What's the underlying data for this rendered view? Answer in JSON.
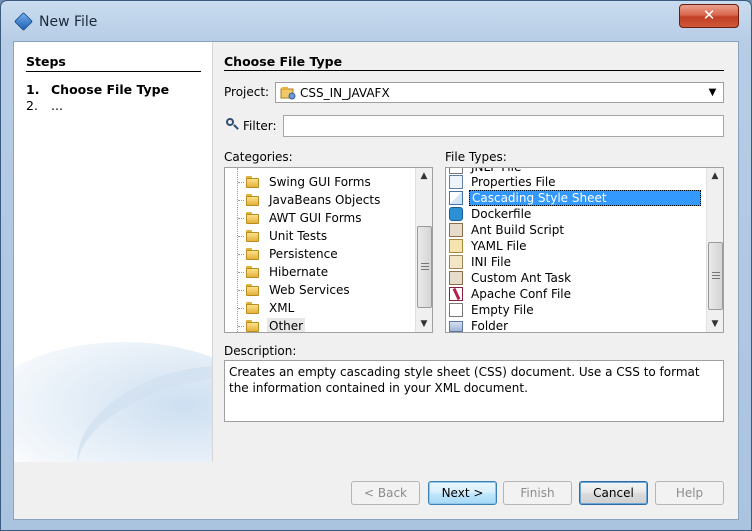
{
  "window": {
    "title": "New File",
    "close_glyph": "✕"
  },
  "steps": {
    "title": "Steps",
    "items": [
      {
        "num": "1.",
        "label": "Choose File Type",
        "active": true
      },
      {
        "num": "2.",
        "label": "...",
        "active": false
      }
    ]
  },
  "main": {
    "title": "Choose File Type",
    "project_label": "Project:",
    "project_value": "CSS_IN_JAVAFX",
    "filter_label": "Filter:",
    "filter_value": "",
    "categories_label": "Categories:",
    "file_types_label": "File Types:",
    "categories": [
      {
        "label": "Swing GUI Forms",
        "icon": "folder-icon"
      },
      {
        "label": "JavaBeans Objects",
        "icon": "folder-icon"
      },
      {
        "label": "AWT GUI Forms",
        "icon": "folder-icon"
      },
      {
        "label": "Unit Tests",
        "icon": "folder-icon"
      },
      {
        "label": "Persistence",
        "icon": "folder-icon"
      },
      {
        "label": "Hibernate",
        "icon": "folder-icon"
      },
      {
        "label": "Web Services",
        "icon": "folder-icon"
      },
      {
        "label": "XML",
        "icon": "folder-icon"
      },
      {
        "label": "Other",
        "icon": "folder-icon",
        "selected": true
      }
    ],
    "file_types": [
      {
        "label": "JNLP File",
        "icon": "jnlp-file-icon"
      },
      {
        "label": "Properties File",
        "icon": "properties-file-icon"
      },
      {
        "label": "Cascading Style Sheet",
        "icon": "css-file-icon",
        "selected": true
      },
      {
        "label": "Dockerfile",
        "icon": "docker-icon"
      },
      {
        "label": "Ant Build Script",
        "icon": "ant-icon"
      },
      {
        "label": "YAML File",
        "icon": "yaml-file-icon"
      },
      {
        "label": "INI File",
        "icon": "ini-file-icon"
      },
      {
        "label": "Custom Ant Task",
        "icon": "ant-task-icon"
      },
      {
        "label": "Apache Conf File",
        "icon": "apache-feather-icon"
      },
      {
        "label": "Empty File",
        "icon": "empty-file-icon"
      },
      {
        "label": "Folder",
        "icon": "folder-icon"
      }
    ],
    "description_label": "Description:",
    "description": "Creates an empty cascading style sheet (CSS) document. Use a CSS to format the information contained in your XML document."
  },
  "buttons": {
    "back": "< Back",
    "next": "Next >",
    "finish": "Finish",
    "cancel": "Cancel",
    "help": "Help"
  },
  "colors": {
    "selection": "#3399ff",
    "close_button": "#c8452b",
    "title_bar": "#b9cfe7"
  }
}
